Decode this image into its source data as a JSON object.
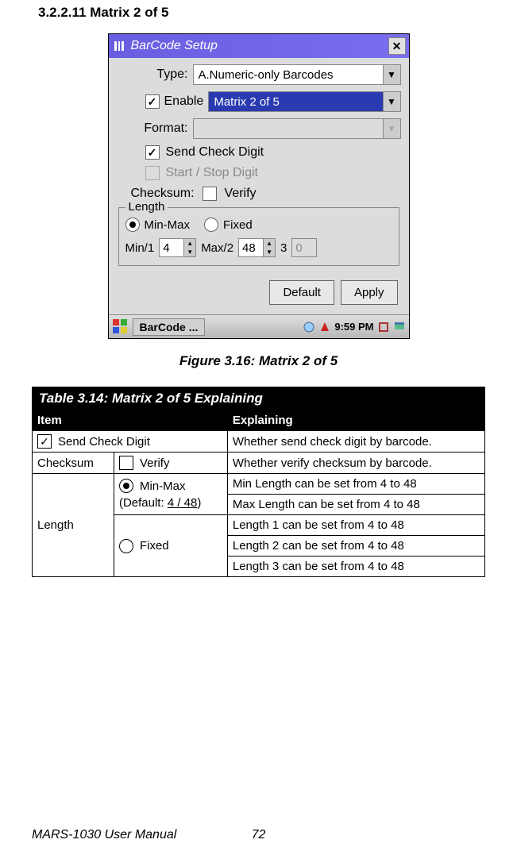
{
  "section_heading": "3.2.2.11 Matrix 2 of 5",
  "window": {
    "title": "BarCode Setup",
    "type_label": "Type:",
    "type_value": "A.Numeric-only Barcodes",
    "enable_label": "Enable",
    "enable_value": "Matrix 2 of 5",
    "format_label": "Format:",
    "send_check_digit": "Send Check Digit",
    "start_stop": "Start / Stop Digit",
    "checksum_label": "Checksum:",
    "verify_label": "Verify",
    "length_legend": "Length",
    "minmax_label": "Min-Max",
    "fixed_label": "Fixed",
    "min1_label": "Min/1",
    "min1_value": "4",
    "max2_label": "Max/2",
    "max2_value": "48",
    "three_label": "3",
    "three_value": "0",
    "btn_default": "Default",
    "btn_apply": "Apply"
  },
  "taskbar": {
    "task_name": "BarCode ...",
    "time": "9:59 PM"
  },
  "figure_caption": "Figure 3.16: Matrix 2 of 5",
  "table": {
    "title": "Table 3.14: Matrix 2 of 5 Explaining",
    "h_item": "Item",
    "h_explain": "Explaining",
    "r1_item": "Send Check Digit",
    "r1_explain": "Whether send check digit by barcode.",
    "r2_item1": "Checksum",
    "r2_item2": "Verify",
    "r2_explain": "Whether verify checksum by barcode.",
    "length_label": "Length",
    "minmax_label": "Min-Max",
    "minmax_default": "(Default: 4 / 48)",
    "min_explain": "Min Length can be set from 4 to 48",
    "max_explain": "Max Length can be set from 4 to 48",
    "fixed_label": "Fixed",
    "len1_explain": "Length 1 can be set from 4 to 48",
    "len2_explain": "Length 2 can be set from 4 to 48",
    "len3_explain": "Length 3 can be set from 4 to 48"
  },
  "footer": {
    "manual": "MARS-1030 User Manual",
    "page": "72"
  }
}
